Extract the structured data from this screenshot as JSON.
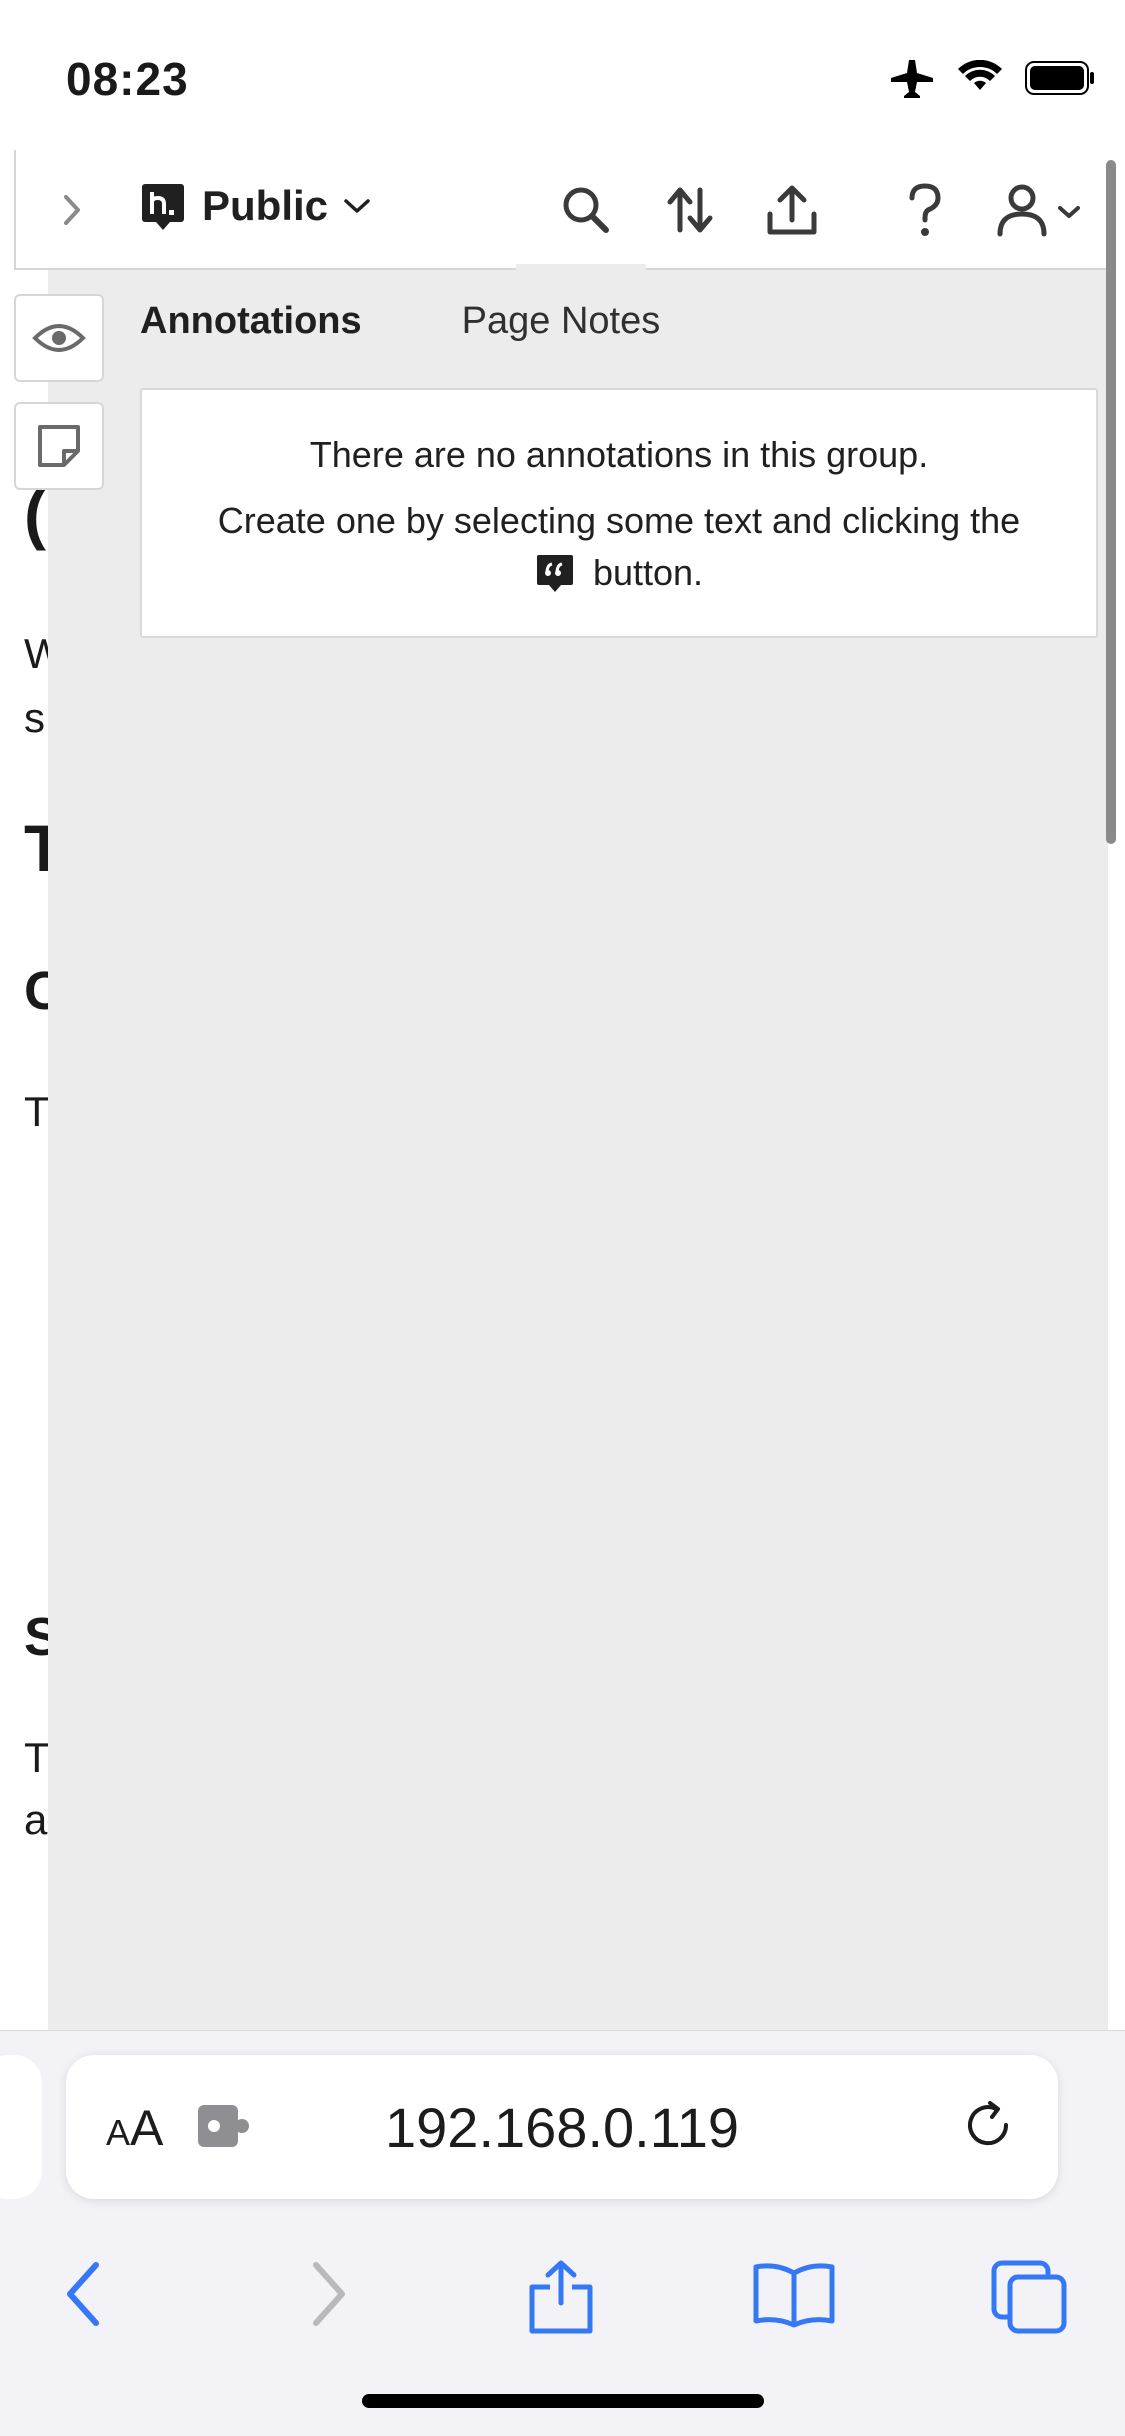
{
  "status": {
    "time": "08:23"
  },
  "background_page": {
    "fragments": [
      "(",
      "W",
      "s",
      "T",
      "C",
      "T",
      "S",
      "T",
      "a"
    ]
  },
  "sidebar": {
    "group_name": "Public",
    "tabs": {
      "annotations": "Annotations",
      "page_notes": "Page Notes"
    },
    "empty_state": {
      "line1": "There are no annotations in this group.",
      "line2": "Create one by selecting some text and clicking the",
      "line3": "button."
    },
    "icons": {
      "collapse": "chevron-right-icon",
      "search": "search-icon",
      "sort": "sort-icon",
      "share": "share-icon",
      "help": "help-icon",
      "account": "user-icon",
      "visibility": "eye-icon",
      "page_note": "note-icon",
      "annotate": "quote-icon"
    }
  },
  "browser": {
    "text_size_label_small": "A",
    "text_size_label_large": "A",
    "url": "192.168.0.119",
    "accent_color": "#3478f6"
  }
}
